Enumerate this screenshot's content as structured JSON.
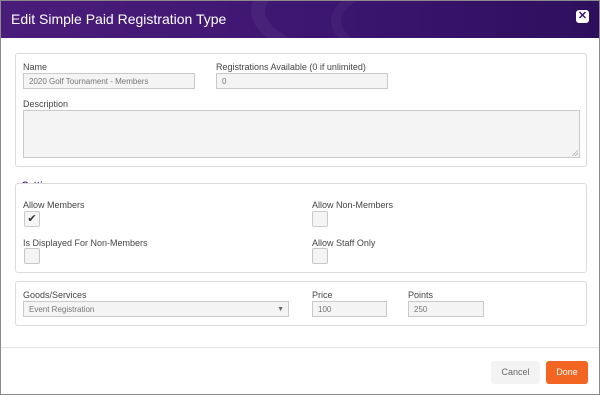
{
  "dialog": {
    "title": "Edit Simple Paid Registration Type",
    "close_icon": "close-icon"
  },
  "general": {
    "name_label": "Name",
    "name_value": "2020 Golf Tournament - Members",
    "available_label": "Registrations Available (0 if unlimited)",
    "available_value": "0",
    "description_label": "Description",
    "description_value": ""
  },
  "settings": {
    "title": "Settings",
    "allow_members_label": "Allow Members",
    "allow_members_checked": true,
    "allow_non_members_label": "Allow Non-Members",
    "allow_non_members_checked": false,
    "displayed_non_members_label": "Is Displayed For Non-Members",
    "displayed_non_members_checked": false,
    "allow_staff_only_label": "Allow Staff Only",
    "allow_staff_only_checked": false,
    "check_glyph": "✔"
  },
  "goods": {
    "label": "Goods/Services",
    "selected": "Event Registration",
    "price_label": "Price",
    "price_value": "100",
    "points_label": "Points",
    "points_value": "250"
  },
  "footer": {
    "cancel_label": "Cancel",
    "done_label": "Done"
  },
  "colors": {
    "header": "#3c1670",
    "primary_button": "#f26522"
  }
}
